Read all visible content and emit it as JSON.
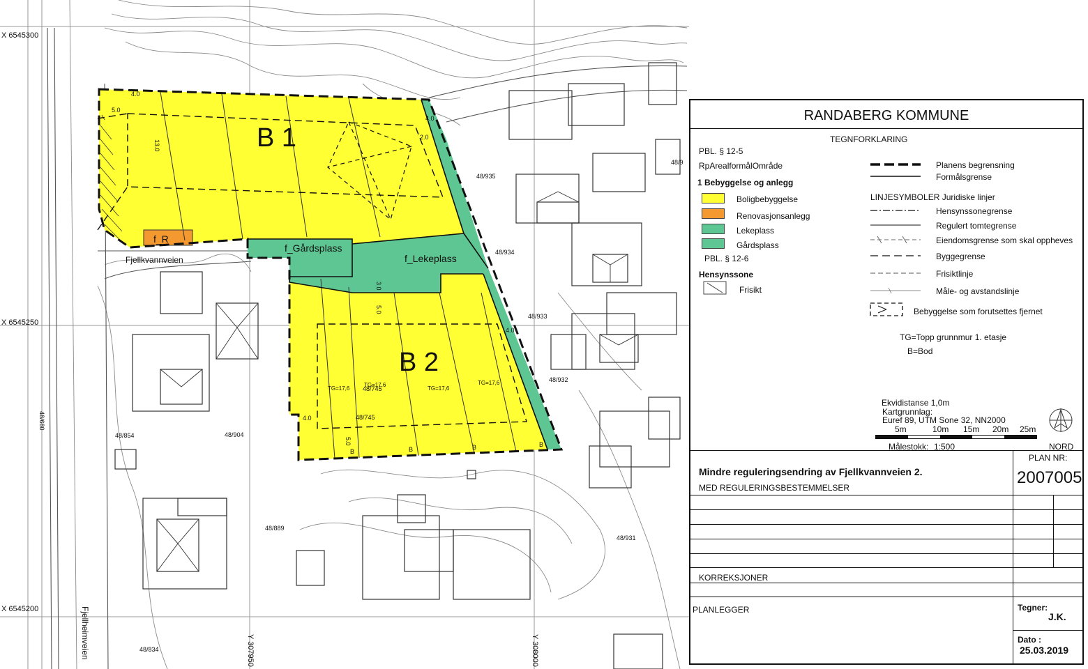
{
  "map": {
    "plots": {
      "b1": "B 1",
      "b2": "B 2",
      "f_r": "f_R",
      "f_gardsplass": "f_Gårdsplass",
      "f_lekeplass": "f_Lekeplass"
    },
    "roads": {
      "fjellkvannveien": "Fjellkvannveien",
      "fjellheimveien": "Fjellheimveien"
    },
    "coords": {
      "x_top": "X 6545300",
      "x_mid": "X 6545250",
      "x_bottom": "X 6545200",
      "y_left": "Y 307950",
      "y_right": "Y 308000"
    },
    "parcels": [
      "48/935",
      "48/934",
      "48/933",
      "48/932",
      "48/931",
      "48/889",
      "48/904",
      "48/854",
      "48/834",
      "48/745",
      "48/745",
      "48/680",
      "48/9"
    ],
    "heights": {
      "h_4_0_a": "4.0",
      "h_5_0_a": "5.0",
      "h_13_0": "13.0",
      "h_4_0_b": "4.0",
      "h_2_0": "2.0",
      "h_3_0": "3.0",
      "h_5_0_b": "5.0",
      "h_4_0_c": "4.0",
      "h_4_0_d": "4.0",
      "h_5_0_c": "5.0"
    },
    "tg_labels": [
      "TG=17,6",
      "TG=17,6",
      "TG=17,6",
      "TG=17,6"
    ],
    "bod_label": "B",
    "colors": {
      "bolig": "#ffff33",
      "renovasjon": "#f4992f",
      "leke": "#5ec692"
    }
  },
  "legend": {
    "municipality": "RANDABERG KOMMUNE",
    "heading": "TEGNFORKLARING",
    "pbl_12_5": "PBL. § 12-5",
    "rp_area": "RpArealformålOmråde",
    "category_1": "1 Bebyggelse og anlegg",
    "items": [
      {
        "label": "Boligbebyggelse",
        "color": "#ffff33"
      },
      {
        "label": "Renovasjonsanlegg",
        "color": "#f4992f"
      },
      {
        "label": "Lekeplass",
        "color": "#5ec692"
      },
      {
        "label": "Gårdsplass",
        "color": "#5ec692"
      }
    ],
    "pbl_12_6": "PBL. § 12-6",
    "hensynssone": "Hensynssone",
    "frisikt": "Frisikt",
    "planens_begrensning": "Planens begrensning",
    "formalsgrense": "Formålsgrense",
    "linjesymboler": "LINJESYMBOLER Juridiske linjer",
    "lines": [
      "Hensynssonegrense",
      "Regulert tomtegrense",
      "Eiendomsgrense som skal oppheves",
      "Byggegrense",
      "Frisiktlinje",
      "Måle- og avstandslinje"
    ],
    "fjernet": "Bebyggelse som forutsettes fjernet",
    "tg_note": "TG=Topp grunnmur 1. etasje",
    "b_note": "B=Bod",
    "ekvidistanse": "Ekvidistanse 1,0m",
    "kartgrunnlag": "Kartgrunnlag:",
    "euref": "Euref 89, UTM Sone 32, NN2000",
    "scale_ticks": [
      "5m",
      "10m",
      "15m",
      "20m",
      "25m"
    ],
    "malestokk_label": "Målestokk:",
    "malestokk_value": "1:500",
    "nord": "NORD"
  },
  "titleblock": {
    "title": "Mindre reguleringsendring av Fjellkvannveien 2.",
    "subtitle": "MED REGULERINGSBESTEMMELSER",
    "plan_nr_label": "PLAN NR:",
    "plan_nr": "2007005",
    "korreksjoner": "KORREKSJONER",
    "planlegger": "PLANLEGGER",
    "tegner_label": "Tegner:",
    "tegner": "J.K.",
    "dato_label": "Dato :",
    "dato": "25.03.2019"
  }
}
